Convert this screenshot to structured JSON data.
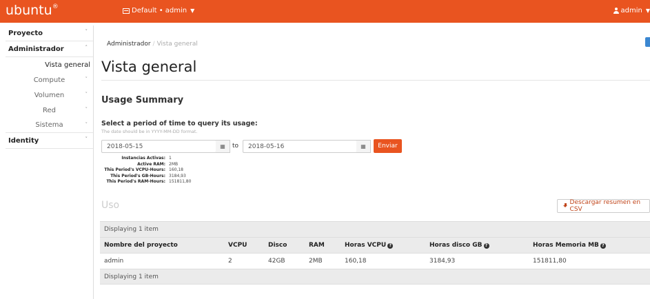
{
  "topbar": {
    "logo": "ubuntu",
    "logo_mark": "®",
    "project_menu": "Default • admin",
    "user_menu": "admin"
  },
  "sidebar": {
    "items": [
      {
        "label": "Proyecto"
      },
      {
        "label": "Administrador"
      },
      {
        "label": "Vista general"
      },
      {
        "label": "Compute"
      },
      {
        "label": "Volumen"
      },
      {
        "label": "Red"
      },
      {
        "label": "Sistema"
      },
      {
        "label": "Identity"
      }
    ]
  },
  "breadcrumb": {
    "root": "Administrador",
    "separator": "/",
    "current": "Vista general"
  },
  "page_title": "Vista general",
  "usage_summary": {
    "heading": "Usage Summary",
    "period_label": "Select a period of time to query its usage:",
    "period_help": "The date should be in YYYY-MM-DD format.",
    "start_date": "2018-05-15",
    "to_label": "to",
    "end_date": "2018-05-16",
    "submit_label": "Enviar",
    "stats": [
      {
        "label": "Instancias Activas:",
        "value": "1"
      },
      {
        "label": "Active RAM:",
        "value": "2MB"
      },
      {
        "label": "This Period's VCPU-Hours:",
        "value": "160,18"
      },
      {
        "label": "This Period's GB-Hours:",
        "value": "3184,93"
      },
      {
        "label": "This Period's RAM-Hours:",
        "value": "151811,80"
      }
    ]
  },
  "usage": {
    "heading": "Uso",
    "csv_button": "Descargar resumen en CSV",
    "displaying_top": "Displaying 1 item",
    "displaying_bottom": "Displaying 1 item",
    "columns": [
      "Nombre del proyecto",
      "VCPU",
      "Disco",
      "RAM",
      "Horas VCPU",
      "Horas disco GB",
      "Horas Memoria MB"
    ],
    "rows": [
      [
        "admin",
        "2",
        "42GB",
        "2MB",
        "160,18",
        "3184,93",
        "151811,80"
      ]
    ]
  },
  "colors": {
    "brand": "#e95420",
    "info_button": "#3b87d1"
  },
  "icons": {
    "project": "project-list-icon",
    "user": "user-icon",
    "calendar": "calendar-icon",
    "download": "download-icon",
    "help": "question-circle-icon",
    "chevron": "chevron-icon"
  }
}
